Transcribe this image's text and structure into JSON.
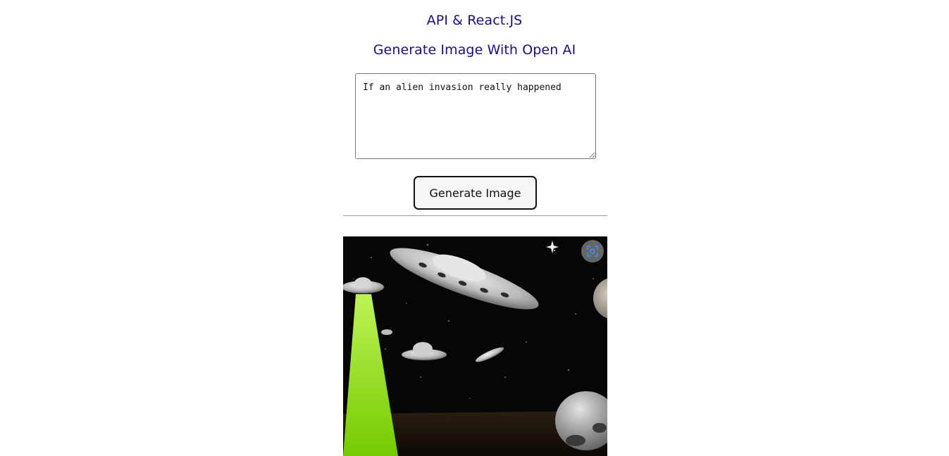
{
  "header": {
    "title": "API & React.JS",
    "subtitle": "Generate Image With Open AI"
  },
  "form": {
    "prompt_value": "If an alien invasion really happened",
    "generate_label": "Generate Image"
  },
  "result": {
    "image_icon": "generated-image",
    "lens_icon": "visual-search-icon"
  }
}
